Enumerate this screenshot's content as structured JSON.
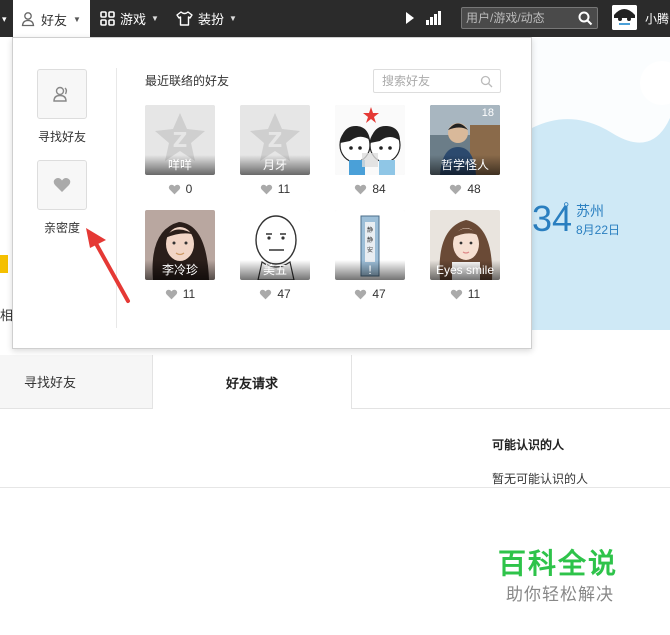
{
  "topbar": {
    "friends_label": "好友",
    "games_label": "游戏",
    "dressup_label": "装扮",
    "search_placeholder": "用户/游戏/动态",
    "username": "小腾"
  },
  "panel": {
    "find_friends_label": "寻找好友",
    "intimacy_label": "亲密度",
    "recent_title": "最近联络的好友",
    "search_placeholder": "搜索好友",
    "friends": [
      {
        "name": "咩咩",
        "intimacy": "0",
        "avatar": "default-qq-avatar"
      },
      {
        "name": "月牙",
        "intimacy": "11",
        "avatar": "default-qq-avatar"
      },
      {
        "name": "",
        "intimacy": "84",
        "avatar": "cartoon-couple"
      },
      {
        "name": "哲学怪人",
        "intimacy": "48",
        "avatar": "photo-person",
        "badge": "18"
      },
      {
        "name": "李冷珍",
        "intimacy": "11",
        "avatar": "photo-girl"
      },
      {
        "name": "美五",
        "intimacy": "47",
        "avatar": "meme-face"
      },
      {
        "name": "!",
        "intimacy": "47",
        "avatar": "book-cover"
      },
      {
        "name": "Eyes smile",
        "intimacy": "11",
        "avatar": "photo-girl-2"
      }
    ]
  },
  "background": {
    "weather_temp": "34",
    "weather_deg": "°",
    "city": "苏州",
    "date": "8月22日",
    "left_char": "相",
    "tabs": {
      "find": "寻找好友",
      "requests": "好友请求"
    },
    "people_title": "可能认识的人",
    "people_empty": "暂无可能认识的人"
  },
  "watermark": {
    "title": "百科全说",
    "subtitle": "助你轻松解决"
  },
  "colors": {
    "topbar": "#2b2b2b",
    "annotation_arrow": "#e53935",
    "watermark_green": "#2ec34a"
  }
}
